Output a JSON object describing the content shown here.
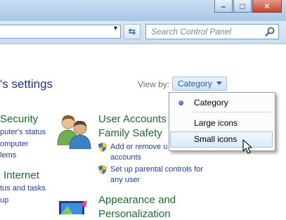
{
  "window": {
    "minimize_glyph": "–",
    "maximize_glyph": "□",
    "close_glyph": "✕"
  },
  "address": {
    "dropdown_glyph": "▼",
    "refresh_glyph": "⇆",
    "search_placeholder": "Search Control Panel"
  },
  "header": {
    "title_partial": "'s settings",
    "view_by_label": "View by:",
    "view_by_value": "Category"
  },
  "view_menu": {
    "items": [
      {
        "label": "Category",
        "selected": true
      },
      {
        "label": "Large icons",
        "selected": false
      },
      {
        "label": "Small icons",
        "selected": false,
        "hovered": true
      }
    ]
  },
  "left_column": {
    "security_title": "Security",
    "security_link1": "puter's status",
    "security_link2": "omputer",
    "security_link3": "lems",
    "internet_title": "Internet",
    "internet_link1": "tus and tasks",
    "internet_link2": "up"
  },
  "right_column": {
    "users_title_line1": "User Accounts",
    "users_title_line2": "Family Safety",
    "users_link1_line1": "Add or remove u",
    "users_link1_line2": "accounts",
    "users_link2_line1": "Set up parental controls for",
    "users_link2_line2": "any user",
    "appearance_title_line1": "Appearance and",
    "appearance_title_line2": "Personalization"
  }
}
